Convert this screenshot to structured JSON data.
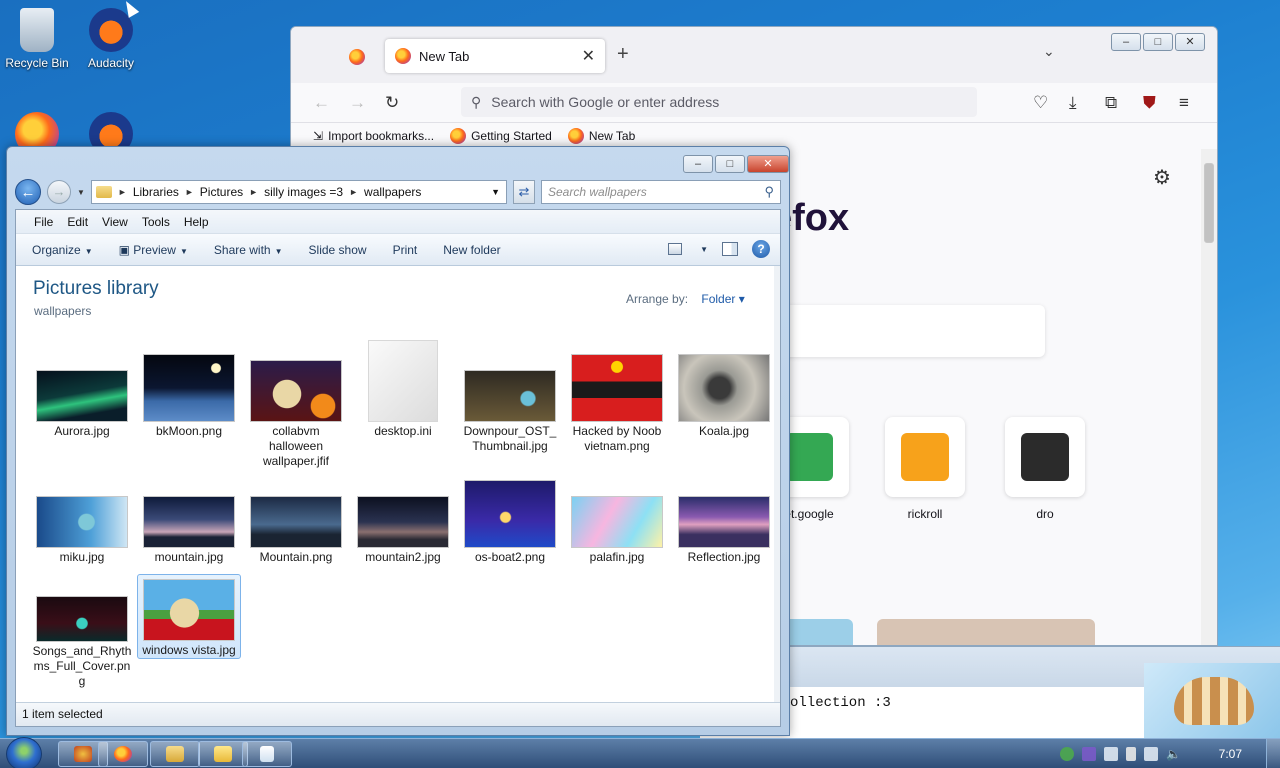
{
  "desktop": {
    "icons": [
      {
        "label": "Recycle Bin",
        "icon": "recycle-bin-icon"
      },
      {
        "label": "Audacity",
        "icon": "audacity-icon"
      },
      {
        "label": "",
        "icon": "firefox-icon"
      },
      {
        "label": "",
        "icon": "audacity-icon"
      }
    ]
  },
  "firefox": {
    "tab_title": "New Tab",
    "url_placeholder": "Search with Google or enter address",
    "bookmarks": [
      "Import bookmarks...",
      "Getting Started",
      "New Tab"
    ],
    "brand_text": "efox",
    "shortcuts": [
      {
        "label": "et.google",
        "color": "#34a853"
      },
      {
        "label": "rickroll",
        "color": "#f7a21b"
      },
      {
        "label": "dro",
        "color": "#2b2b2b"
      }
    ]
  },
  "terminal": {
    "line": "ollection :3"
  },
  "explorer": {
    "breadcrumb": [
      "Libraries",
      "Pictures",
      "silly images =3",
      "wallpapers"
    ],
    "search_placeholder": "Search wallpapers",
    "menu": [
      "File",
      "Edit",
      "View",
      "Tools",
      "Help"
    ],
    "toolbar": {
      "organize": "Organize",
      "preview": "Preview",
      "share": "Share with",
      "slideshow": "Slide show",
      "print": "Print",
      "new_folder": "New folder"
    },
    "library_title": "Pictures library",
    "library_sub": "wallpapers",
    "arrange_label": "Arrange by:",
    "arrange_value": "Folder",
    "files": [
      {
        "name": "Aurora.jpg",
        "thumb": "aurora",
        "selected": false
      },
      {
        "name": "bkMoon.png",
        "thumb": "moon",
        "selected": false
      },
      {
        "name": "collabvm halloween wallpaper.jfif",
        "thumb": "collab",
        "selected": false
      },
      {
        "name": "desktop.ini",
        "thumb": "ini",
        "selected": false
      },
      {
        "name": "Downpour_OST_Thumbnail.jpg",
        "thumb": "downpour",
        "selected": false
      },
      {
        "name": "Hacked by Noob vietnam.png",
        "thumb": "hacked",
        "selected": false
      },
      {
        "name": "Koala.jpg",
        "thumb": "koala",
        "selected": false
      },
      {
        "name": "miku.jpg",
        "thumb": "miku",
        "selected": false
      },
      {
        "name": "mountain.jpg",
        "thumb": "mountain",
        "selected": false
      },
      {
        "name": "Mountain.png",
        "thumb": "mountain2",
        "selected": false
      },
      {
        "name": "mountain2.jpg",
        "thumb": "mountain3",
        "selected": false
      },
      {
        "name": "os-boat2.png",
        "thumb": "boat",
        "selected": false
      },
      {
        "name": "palafin.jpg",
        "thumb": "palafin",
        "selected": false
      },
      {
        "name": "Reflection.jpg",
        "thumb": "reflection",
        "selected": false
      },
      {
        "name": "Songs_and_Rhythms_Full_Cover.png",
        "thumb": "songs",
        "selected": false
      },
      {
        "name": "windows vista.jpg",
        "thumb": "vista",
        "selected": true
      }
    ],
    "status": "1 item selected"
  },
  "taskbar": {
    "clock": "7:07",
    "buttons": [
      "taskbar-app-icon",
      "firefox-icon",
      "explorer-icon",
      "folder-icon",
      "notepad-icon"
    ]
  }
}
